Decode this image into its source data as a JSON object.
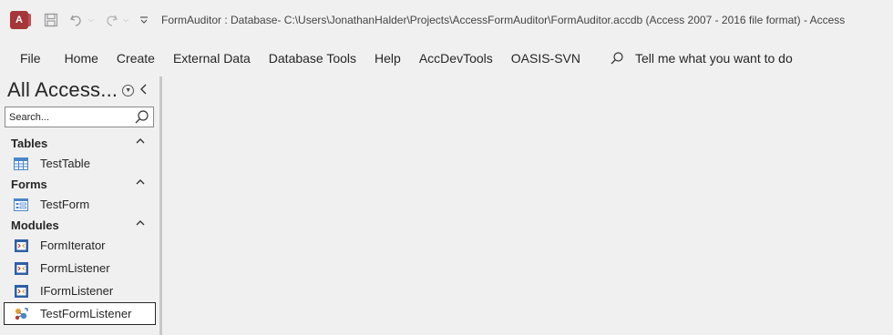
{
  "titlebar": {
    "app_logo": "A",
    "title": "FormAuditor : Database- C:\\Users\\JonathanHalder\\Projects\\AccessFormAuditor\\FormAuditor.accdb (Access 2007 - 2016 file format)  -  Access",
    "icons": [
      "access-logo-icon",
      "save-icon",
      "undo-icon",
      "redo-icon",
      "customize-toolbar-icon"
    ]
  },
  "ribbon": {
    "tabs": [
      "File",
      "Home",
      "Create",
      "External Data",
      "Database Tools",
      "Help",
      "AccDevTools",
      "OASIS-SVN"
    ],
    "tell_me": "Tell me what you want to do"
  },
  "nav": {
    "title": "All Access...",
    "search": {
      "placeholder": "Search..."
    },
    "groups": [
      {
        "label": "Tables",
        "items": [
          {
            "label": "TestTable",
            "icon": "table-icon"
          }
        ]
      },
      {
        "label": "Forms",
        "items": [
          {
            "label": "TestForm",
            "icon": "form-icon"
          }
        ]
      },
      {
        "label": "Modules",
        "items": [
          {
            "label": "FormIterator",
            "icon": "module-icon"
          },
          {
            "label": "FormListener",
            "icon": "module-icon"
          },
          {
            "label": "IFormListener",
            "icon": "module-icon"
          },
          {
            "label": "TestFormListener",
            "icon": "class-module-icon",
            "selected": true
          }
        ]
      }
    ]
  },
  "colors": {
    "access_brand": "#a4373a",
    "background": "#f0f0f0"
  }
}
